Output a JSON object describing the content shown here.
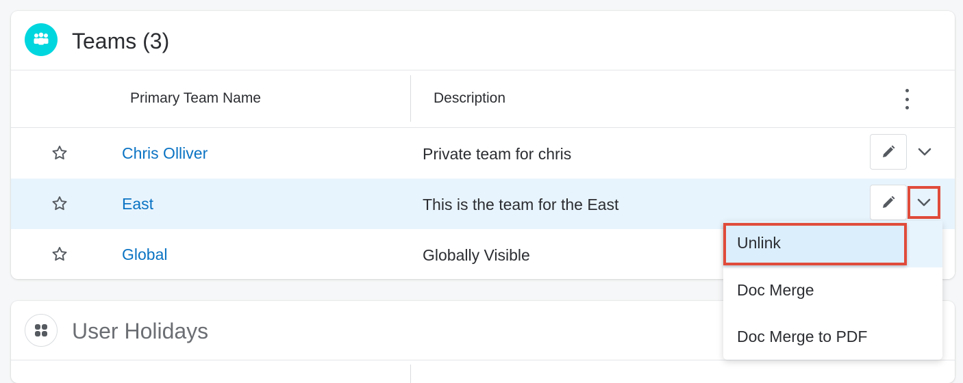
{
  "teams": {
    "title": "Teams (3)",
    "icon": "teams-icon",
    "accent_color": "#00d6de",
    "columns": {
      "name": "Primary Team Name",
      "description": "Description"
    },
    "rows": [
      {
        "name": "Chris Olliver",
        "description": "Private team for chris"
      },
      {
        "name": "East",
        "description": "This is the team for the East"
      },
      {
        "name": "Global",
        "description": "Globally Visible"
      }
    ]
  },
  "holidays": {
    "title": "User Holidays",
    "icon": "grid-icon"
  },
  "dropdown": {
    "items": [
      "Unlink",
      "Doc Merge",
      "Doc Merge to PDF"
    ]
  },
  "colors": {
    "link": "#0a73c3",
    "highlight_row": "#e8f4fd",
    "annotation": "#e04b3a"
  }
}
